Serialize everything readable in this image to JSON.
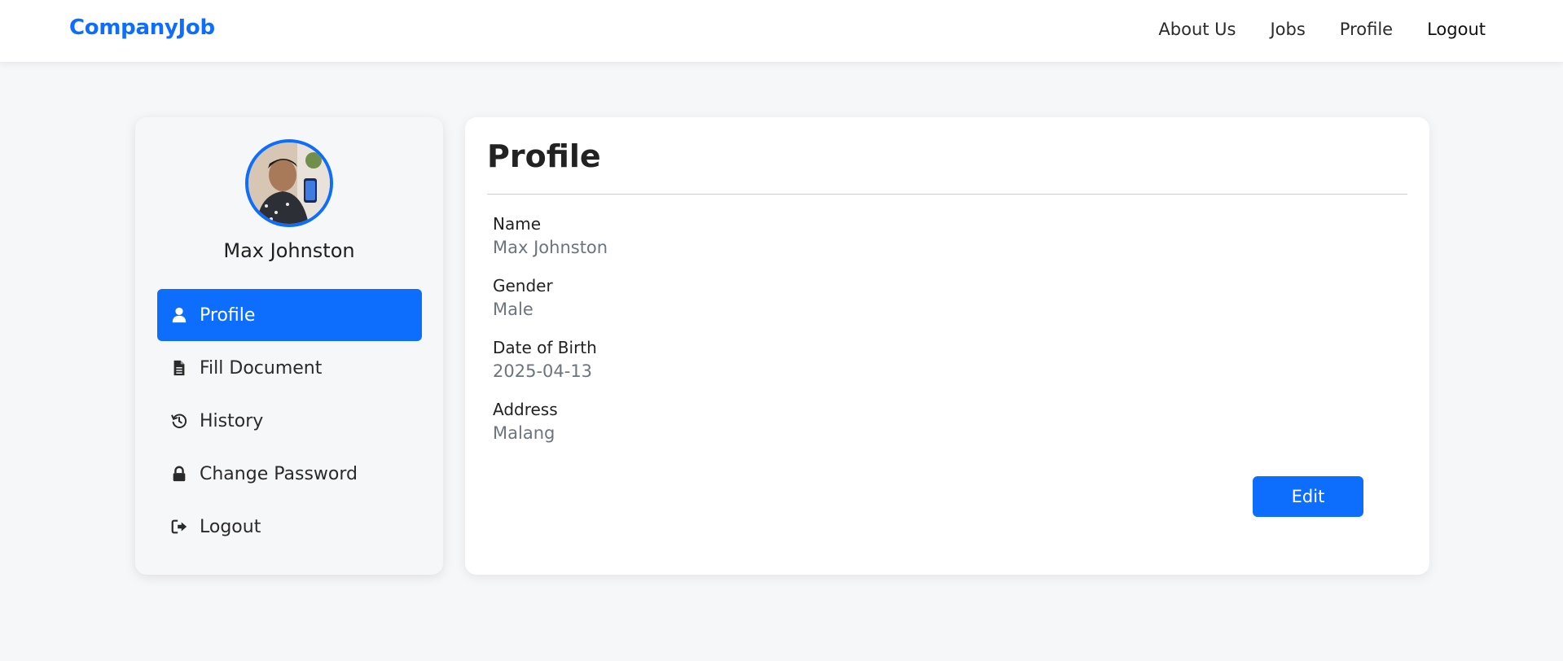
{
  "navbar": {
    "brand": "CompanyJob",
    "links": [
      {
        "label": "About Us"
      },
      {
        "label": "Jobs"
      },
      {
        "label": "Profile"
      },
      {
        "label": "Logout"
      }
    ]
  },
  "sidebar": {
    "user_name": "Max Johnston",
    "items": [
      {
        "label": "Profile",
        "icon": "user-icon",
        "active": true
      },
      {
        "label": "Fill Document",
        "icon": "file-text-icon"
      },
      {
        "label": "History",
        "icon": "history-icon"
      },
      {
        "label": "Change Password",
        "icon": "lock-icon"
      },
      {
        "label": "Logout",
        "icon": "sign-out-icon"
      }
    ]
  },
  "main": {
    "title": "Profile",
    "fields": [
      {
        "label": "Name",
        "value": "Max Johnston"
      },
      {
        "label": "Gender",
        "value": "Male"
      },
      {
        "label": "Date of Birth",
        "value": "2025-04-13"
      },
      {
        "label": "Address",
        "value": "Malang"
      }
    ],
    "edit_label": "Edit"
  },
  "colors": {
    "accent": "#0d6efd",
    "page_bg": "#f6f7f9",
    "muted_text": "#6c757d"
  }
}
